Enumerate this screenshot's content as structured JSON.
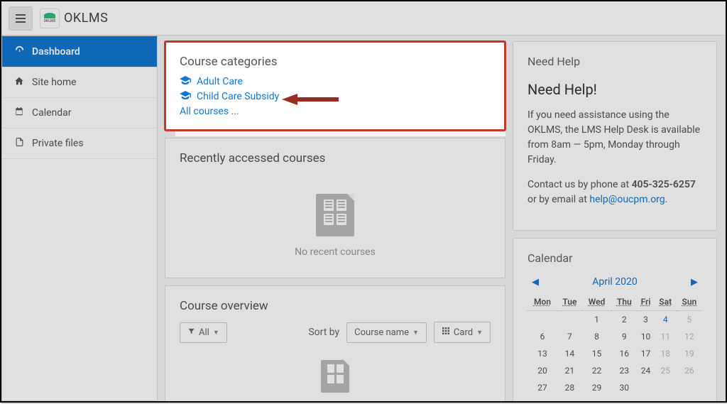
{
  "brand": "OKLMS",
  "logo_sub": "OKLMS",
  "sidebar": {
    "items": [
      {
        "label": "Dashboard",
        "icon": "dashboard-icon",
        "active": true
      },
      {
        "label": "Site home",
        "icon": "home-icon",
        "active": false
      },
      {
        "label": "Calendar",
        "icon": "calendar-icon",
        "active": false
      },
      {
        "label": "Private files",
        "icon": "file-icon",
        "active": false
      }
    ]
  },
  "categories": {
    "title": "Course categories",
    "items": [
      {
        "label": "Adult Care"
      },
      {
        "label": "Child Care Subsidy"
      }
    ],
    "all_label": "All courses",
    "all_suffix": " ..."
  },
  "recent": {
    "title": "Recently accessed courses",
    "empty_text": "No recent courses"
  },
  "overview": {
    "title": "Course overview",
    "filter_label": "All",
    "sort_label": "Sort by",
    "sort_value": "Course name",
    "view_label": "Card"
  },
  "help": {
    "subtitle": "Need Help",
    "heading": "Need Help!",
    "p1": "If you need assistance using the OKLMS, the LMS Help Desk is available from 8am — 5pm, Monday through Friday.",
    "p2a": "Contact us by phone at ",
    "phone": "405-325-6257",
    "p2b": " or by email at ",
    "email": "help@oucpm.org",
    "p2c": "."
  },
  "calendar": {
    "title": "Calendar",
    "month": "April 2020",
    "days": [
      "Mon",
      "Tue",
      "Wed",
      "Thu",
      "Fri",
      "Sat",
      "Sun"
    ],
    "weeks": [
      [
        "",
        "",
        "1",
        "2",
        "3",
        "4",
        "5"
      ],
      [
        "6",
        "7",
        "8",
        "9",
        "10",
        "11",
        "12"
      ],
      [
        "13",
        "14",
        "15",
        "16",
        "17",
        "18",
        "19"
      ],
      [
        "20",
        "21",
        "22",
        "23",
        "24",
        "25",
        "26"
      ],
      [
        "27",
        "28",
        "29",
        "30",
        "",
        "",
        ""
      ]
    ],
    "today": "4",
    "dim": [
      "4",
      "5",
      "11",
      "12",
      "18",
      "19",
      "25",
      "26"
    ]
  }
}
